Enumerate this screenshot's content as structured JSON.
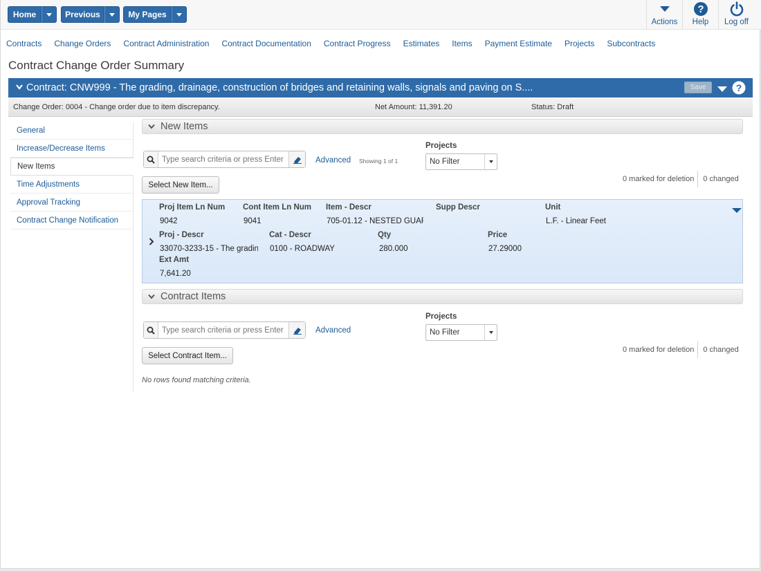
{
  "topbar": {
    "home_label": "Home",
    "previous_label": "Previous",
    "mypages_label": "My Pages",
    "actions_label": "Actions",
    "help_label": "Help",
    "logoff_label": "Log off"
  },
  "nav": [
    "Contracts",
    "Change Orders",
    "Contract Administration",
    "Contract Documentation",
    "Contract Progress",
    "Estimates",
    "Items",
    "Payment Estimate",
    "Projects",
    "Subcontracts"
  ],
  "page_title": "Contract Change Order Summary",
  "contract": {
    "title": "Contract: CNW999 - The grading, drainage, construction of bridges and retaining walls, signals and paving on S....",
    "save_label": "Save"
  },
  "info": {
    "change_order": "Change Order: 0004 - Change order due to item discrepancy.",
    "net_amount": "Net Amount: 11,391.20",
    "status": "Status: Draft"
  },
  "sidenav": [
    "General",
    "Increase/Decrease Items",
    "New Items",
    "Time Adjustments",
    "Approval Tracking",
    "Contract Change Notification"
  ],
  "new_items": {
    "header": "New Items",
    "search_placeholder": "Type search criteria or press Enter",
    "advanced": "Advanced",
    "showing": "Showing 1 of 1",
    "projects_label": "Projects",
    "projects_value": "No Filter",
    "select_button": "Select New Item...",
    "marked_deletion": "0 marked for deletion",
    "changed": "0 changed",
    "record": {
      "proj_item_ln_num_h": "Proj Item Ln Num",
      "proj_item_ln_num": "9042",
      "cont_item_ln_num_h": "Cont Item Ln Num",
      "cont_item_ln_num": "9041",
      "item_descr_h": "Item - Descr",
      "item_descr": "705-01.12 - NESTED GUAR",
      "supp_descr_h": "Supp Descr",
      "supp_descr": "",
      "unit_h": "Unit",
      "unit": "L.F. - Linear Feet",
      "proj_descr_h": "Proj - Descr",
      "proj_descr": "33070-3233-15 - The gradin",
      "cat_descr_h": "Cat - Descr",
      "cat_descr": "0100 - ROADWAY",
      "qty_h": "Qty",
      "qty": "280.000",
      "price_h": "Price",
      "price": "27.29000",
      "ext_amt_h": "Ext Amt",
      "ext_amt": "7,641.20"
    }
  },
  "contract_items": {
    "header": "Contract Items",
    "search_placeholder": "Type search criteria or press Enter",
    "advanced": "Advanced",
    "projects_label": "Projects",
    "projects_value": "No Filter",
    "select_button": "Select Contract Item...",
    "marked_deletion": "0 marked for deletion",
    "changed": "0 changed",
    "empty_message": "No rows found matching criteria."
  }
}
